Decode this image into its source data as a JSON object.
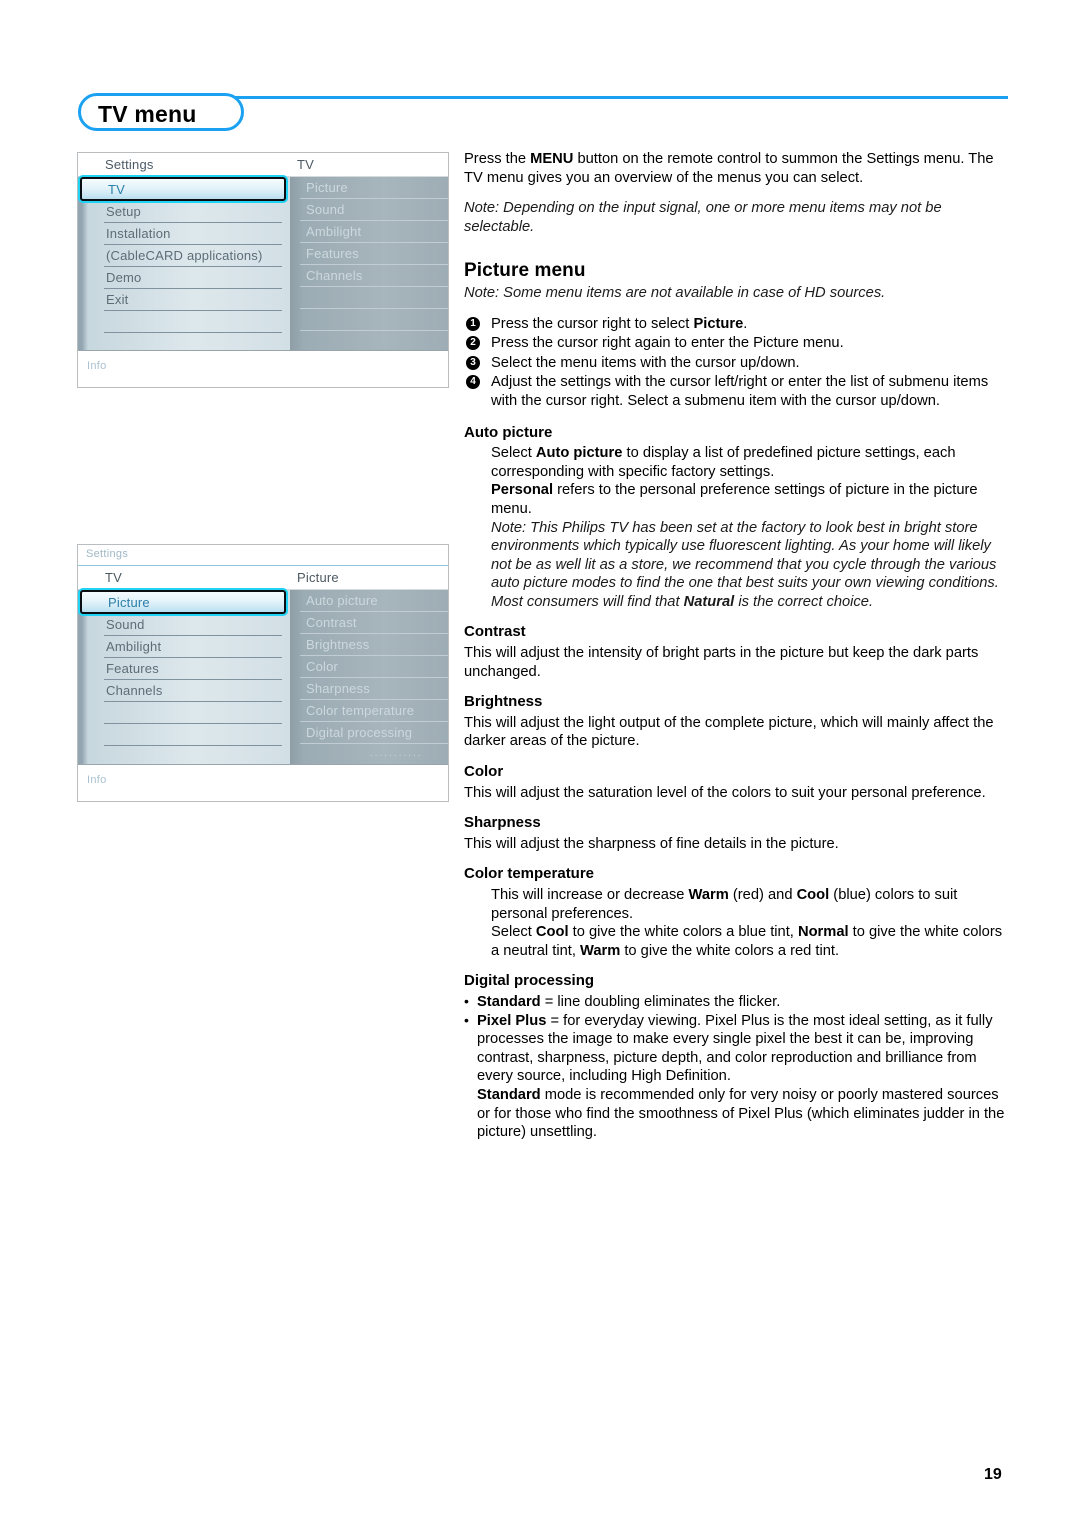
{
  "page": {
    "title": "TV menu",
    "number": "19",
    "accent_color": "#1ba1f2"
  },
  "osd_menus": [
    {
      "name": "tv-menu-screen",
      "has_breadcrumb": false,
      "header_left": "Settings",
      "header_right": "TV",
      "left_items": [
        "TV",
        "Setup",
        "Installation",
        "(CableCARD applications)",
        "Demo",
        "Exit",
        "",
        ""
      ],
      "left_selected_index": 0,
      "right_items": [
        "Picture",
        "Sound",
        "Ambilight",
        "Features",
        "Channels",
        "",
        "",
        ""
      ],
      "has_dots": false,
      "info_label": "Info"
    },
    {
      "name": "picture-menu-screen",
      "has_breadcrumb": true,
      "breadcrumb": "Settings",
      "header_left": "TV",
      "header_right": "Picture",
      "left_items": [
        "Picture",
        "Sound",
        "Ambilight",
        "Features",
        "Channels",
        "",
        "",
        ""
      ],
      "left_selected_index": 0,
      "right_items": [
        "Auto picture",
        "Contrast",
        "Brightness",
        "Color",
        "Sharpness",
        "Color temperature",
        "Digital processing"
      ],
      "has_dots": true,
      "dots": "...........",
      "info_label": "Info"
    }
  ],
  "content": {
    "intro": {
      "line1_a": "Press the ",
      "line1_b": "MENU",
      "line1_c": " button on the remote control to summon the Settings menu. The TV menu gives you an overview of the menus you can select."
    },
    "intro_note": "Note: Depending on the input signal, one or more menu items may not be selectable.",
    "picture_menu": {
      "heading": "Picture menu",
      "note": "Note: Some menu items are not available in case of HD sources.",
      "steps": [
        {
          "num": "1",
          "text_a": "Press the cursor right to select ",
          "bold": "Picture",
          "text_b": "."
        },
        {
          "num": "2",
          "text_a": "Press the cursor right again to enter the Picture menu.",
          "bold": "",
          "text_b": ""
        },
        {
          "num": "3",
          "text_a": "Select the menu items with the cursor up/down.",
          "bold": "",
          "text_b": ""
        },
        {
          "num": "4",
          "text_a": "Adjust the settings with the cursor left/right or enter the list of submenu items with the cursor right. Select a submenu item with the cursor up/down.",
          "bold": "",
          "text_b": ""
        }
      ]
    },
    "sections": [
      {
        "title": "Auto picture",
        "p1_a": "Select ",
        "p1_b": "Auto picture",
        "p1_c": " to display a list of predefined picture settings, each corresponding with specific factory settings.",
        "p2_b": "Personal",
        "p2_c": " refers to the personal preference settings of picture in the picture menu.",
        "note_a": "Note: This Philips TV has been set at the factory to look best in bright store environments which typically use fluorescent lighting. As your home will likely not be as well lit as a store, we recommend that you cycle through the various auto picture modes to find the one that best suits your own viewing conditions. Most consumers will find that ",
        "note_b": "Natural",
        "note_c": " is the correct choice."
      },
      {
        "title": "Contrast",
        "body": "This will adjust the intensity of bright parts in the picture but keep the dark parts unchanged."
      },
      {
        "title": "Brightness",
        "body": "This will adjust the light output of the complete picture, which will mainly affect the darker areas of the picture."
      },
      {
        "title": "Color",
        "body": "This will adjust the saturation level of the colors to suit your personal preference."
      },
      {
        "title": "Sharpness",
        "body": "This will adjust the sharpness of fine details in the picture."
      },
      {
        "title": "Color temperature",
        "p1_a": "This will increase or decrease ",
        "p1_b": "Warm",
        "p1_c": " (red) and ",
        "p1_d": "Cool",
        "p1_e": " (blue) colors to suit personal preferences.",
        "p2_a": "Select ",
        "p2_b": "Cool",
        "p2_c": " to give the white colors a blue tint, ",
        "p2_d": "Normal",
        "p2_e": " to give the white colors a neutral tint, ",
        "p2_f": "Warm",
        "p2_g": " to give the white colors a red tint."
      }
    ],
    "digital_processing": {
      "title": "Digital processing",
      "bullet1_b": "Standard",
      "bullet1_c": " = line doubling eliminates the flicker.",
      "bullet2_b": "Pixel Plus",
      "bullet2_c": " = for everyday viewing. Pixel Plus is the most ideal setting, as it fully processes the image to make every single pixel the best it can be, improving contrast, sharpness, picture depth, and color reproduction and brilliance from every source, including High Definition.",
      "closing_b": "Standard",
      "closing_c": " mode is recommended only for very noisy or poorly mastered sources or for those who find the smoothness of Pixel Plus (which eliminates judder in the picture) unsettling."
    }
  }
}
